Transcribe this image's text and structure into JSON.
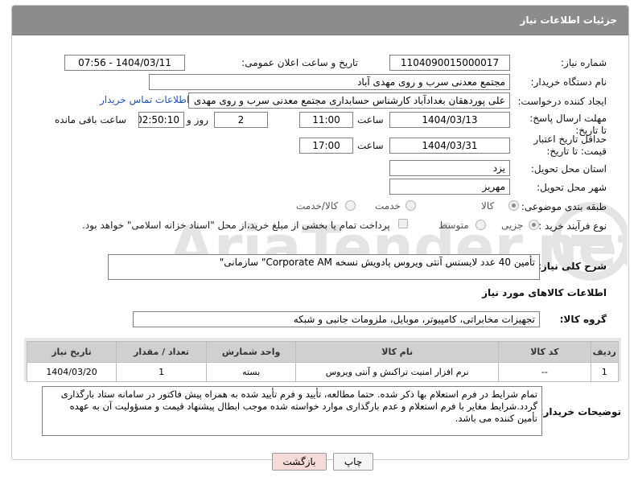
{
  "header": {
    "title": "جزئیات اطلاعات نیاز"
  },
  "labels": {
    "need_number": "شماره نیاز:",
    "announce_datetime": "تاریخ و ساعت اعلان عمومی:",
    "buyer_org": "نام دستگاه خریدار:",
    "requester": "ایجاد کننده درخواست:",
    "reply_deadline": "مهلت ارسال پاسخ: تا تاریخ:",
    "price_validity": "حداقل تاریخ اعتبار قیمت: تا تاریخ:",
    "delivery_province": "استان محل تحویل:",
    "delivery_city": "شهر محل تحویل:",
    "category": "طبقه بندی موضوعی:",
    "process_type": "نوع فرآیند خرید :",
    "hour": "ساعت",
    "day_and": "روز و",
    "remaining": "ساعت باقی مانده",
    "general_desc": "شرح کلی نیاز:",
    "goods_info": "اطلاعات کالاهای مورد نیاز",
    "goods_group": "گروه کالا:",
    "buyer_notes": "توضیحات خریدار:"
  },
  "fields": {
    "need_number": "1104090015000017",
    "announce_datetime": "1404/03/11 - 07:56",
    "buyer_org": "مجتمع معدنی سرب و روی مهدی آباد",
    "requester": "علی پوردهقان بغدادآباد کارشناس حسابداری مجتمع معدنی سرب و روی مهدی",
    "requester_link": "اطلاعات تماس خریدار",
    "reply_date": "1404/03/13",
    "reply_time": "11:00",
    "reply_days": "2",
    "reply_remaining": "02:50:10",
    "validity_date": "1404/03/31",
    "validity_time": "17:00",
    "province": "یزد",
    "city": "مهریز",
    "general_desc": "تأمین 40 عدد لایسنس آنتی ویروس پادویش نسخه  Corporate AM\" سازمانی\"",
    "goods_group": "تجهیزات مخابراتی، کامپیوتر، موبایل، ملزومات جانبی و شبکه",
    "buyer_notes": "تمام شرایط در فرم استعلام بها ذکر شده. حتما مطالعه، تأیید و فرم تأیید شده به همراه پیش فاکتور در سامانه ستاد بارگذاری گردد.شرایط مغایر با فرم استعلام و عدم بارگذاری موارد خواسته شده موجب ابطال پیشنهاد قیمت و مسؤولیت آن به عهده تأمین کننده می باشد."
  },
  "category_options": [
    {
      "label": "کالا",
      "selected": true
    },
    {
      "label": "خدمت",
      "selected": false
    },
    {
      "label": "کالا/خدمت",
      "selected": false
    }
  ],
  "process_options": [
    {
      "label": "جزیی",
      "selected": true
    },
    {
      "label": "متوسط",
      "selected": false
    }
  ],
  "process_note": "پرداخت تمام یا بخشی از مبلغ خرید،از محل \"اسناد خزانه اسلامی\" خواهد بود.",
  "table": {
    "headers": [
      "ردیف",
      "کد کالا",
      "نام کالا",
      "واحد شمارش",
      "تعداد / مقدار",
      "تاریخ نیاز"
    ],
    "rows": [
      [
        "1",
        "--",
        "نرم افزار امنیت تراکنش و آنتی ویروس",
        "بسته",
        "1",
        "1404/03/20"
      ]
    ]
  },
  "buttons": {
    "print": "چاپ",
    "back": "بازگشت"
  },
  "watermark": "AriaTender.net",
  "colors": {
    "titlebar": "#8c8c8c",
    "link": "#2255aa",
    "back_button": "#f6dada",
    "table_header": "#d0d0d0"
  }
}
